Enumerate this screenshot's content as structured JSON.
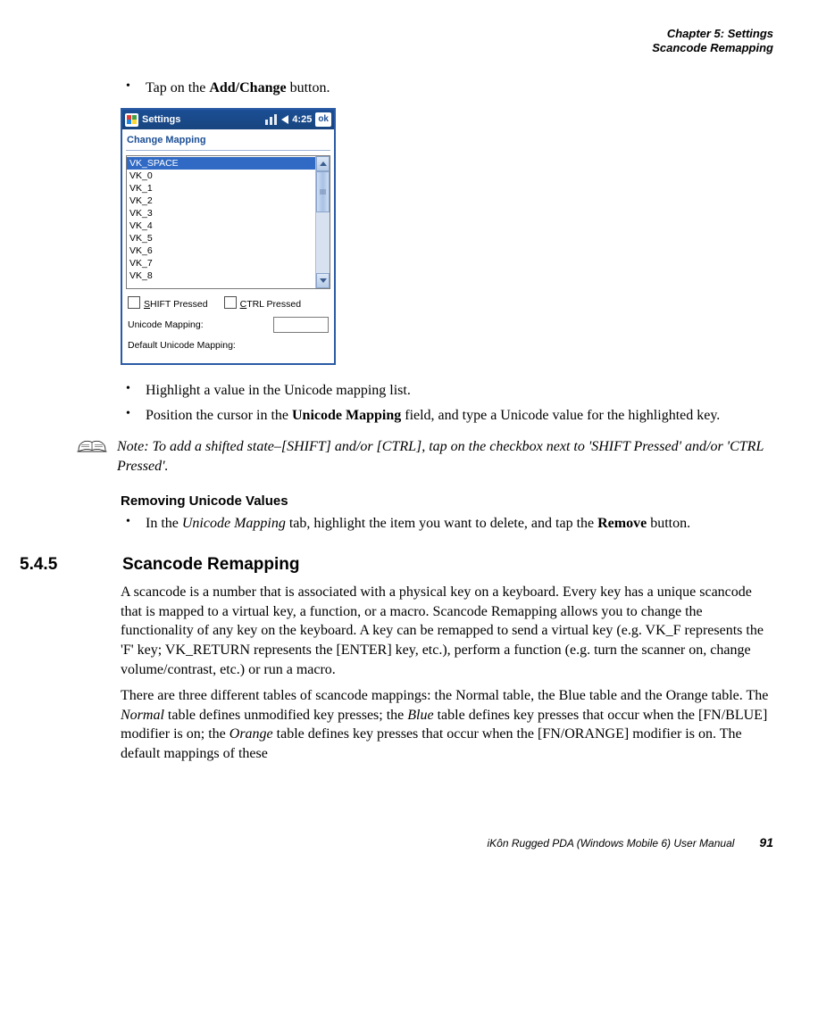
{
  "header": {
    "line1": "Chapter 5:  Settings",
    "line2": "Scancode Remapping"
  },
  "bullets1": {
    "b1_pre": "Tap on the ",
    "b1_bold": "Add/Change",
    "b1_post": " button."
  },
  "wm": {
    "title": "Settings",
    "time": "4:25",
    "ok": "ok",
    "dialog_title": "Change Mapping",
    "list": [
      "VK_SPACE",
      "VK_0",
      "VK_1",
      "VK_2",
      "VK_3",
      "VK_4",
      "VK_5",
      "VK_6",
      "VK_7",
      "VK_8"
    ],
    "shift_label_u": "S",
    "shift_label_rest": "HIFT Pressed",
    "ctrl_label_u": "C",
    "ctrl_label_rest": "TRL Pressed",
    "unicode_label": "Unicode Mapping:",
    "default_label": "Default Unicode Mapping:"
  },
  "bullets2": {
    "b1": "Highlight a value in the Unicode mapping list.",
    "b2_pre": "Position the cursor in the ",
    "b2_bold": "Unicode Mapping",
    "b2_post": " field, and type a Unicode value for the highlighted key."
  },
  "note": {
    "label": "Note:",
    "text": "To add a shifted state–[SHIFT] and/or [CTRL], tap on the checkbox next to 'SHIFT Pressed' and/or 'CTRL Pressed'."
  },
  "sub1": {
    "heading": "Removing Unicode Values",
    "bullet_pre": "In the ",
    "bullet_italic": "Unicode Mapping",
    "bullet_mid": " tab, highlight the item you want to delete, and tap the ",
    "bullet_bold": "Remove",
    "bullet_post": " button."
  },
  "h2": {
    "num": "5.4.5",
    "title": "Scancode Remapping"
  },
  "p1": "A scancode is a number that is associated with a physical key on a keyboard. Every key has a unique scancode that is mapped to a virtual key, a function, or a macro. Scancode Remapping allows you to change the functionality of any key on the keyboard. A key can be remapped to send a virtual key (e.g. VK_F represents the 'F' key; VK_RETURN represents the [ENTER] key, etc.), perform a function (e.g. turn the scanner on, change volume/contrast, etc.) or run a macro.",
  "p2_a": "There are three different tables of scancode mappings: the Normal table, the Blue table and the Orange table. The ",
  "p2_i1": "Normal",
  "p2_b": " table defines unmodified key presses; the ",
  "p2_i2": "Blue",
  "p2_c": " table defines key presses that occur when the [FN/BLUE] modifier is on; the ",
  "p2_i3": "Orange",
  "p2_d": " table defines key presses that occur when the [FN/ORANGE] modifier is on. The default mappings of these",
  "footer": {
    "manual": "iKôn Rugged PDA (Windows Mobile 6) User Manual",
    "page": "91"
  }
}
